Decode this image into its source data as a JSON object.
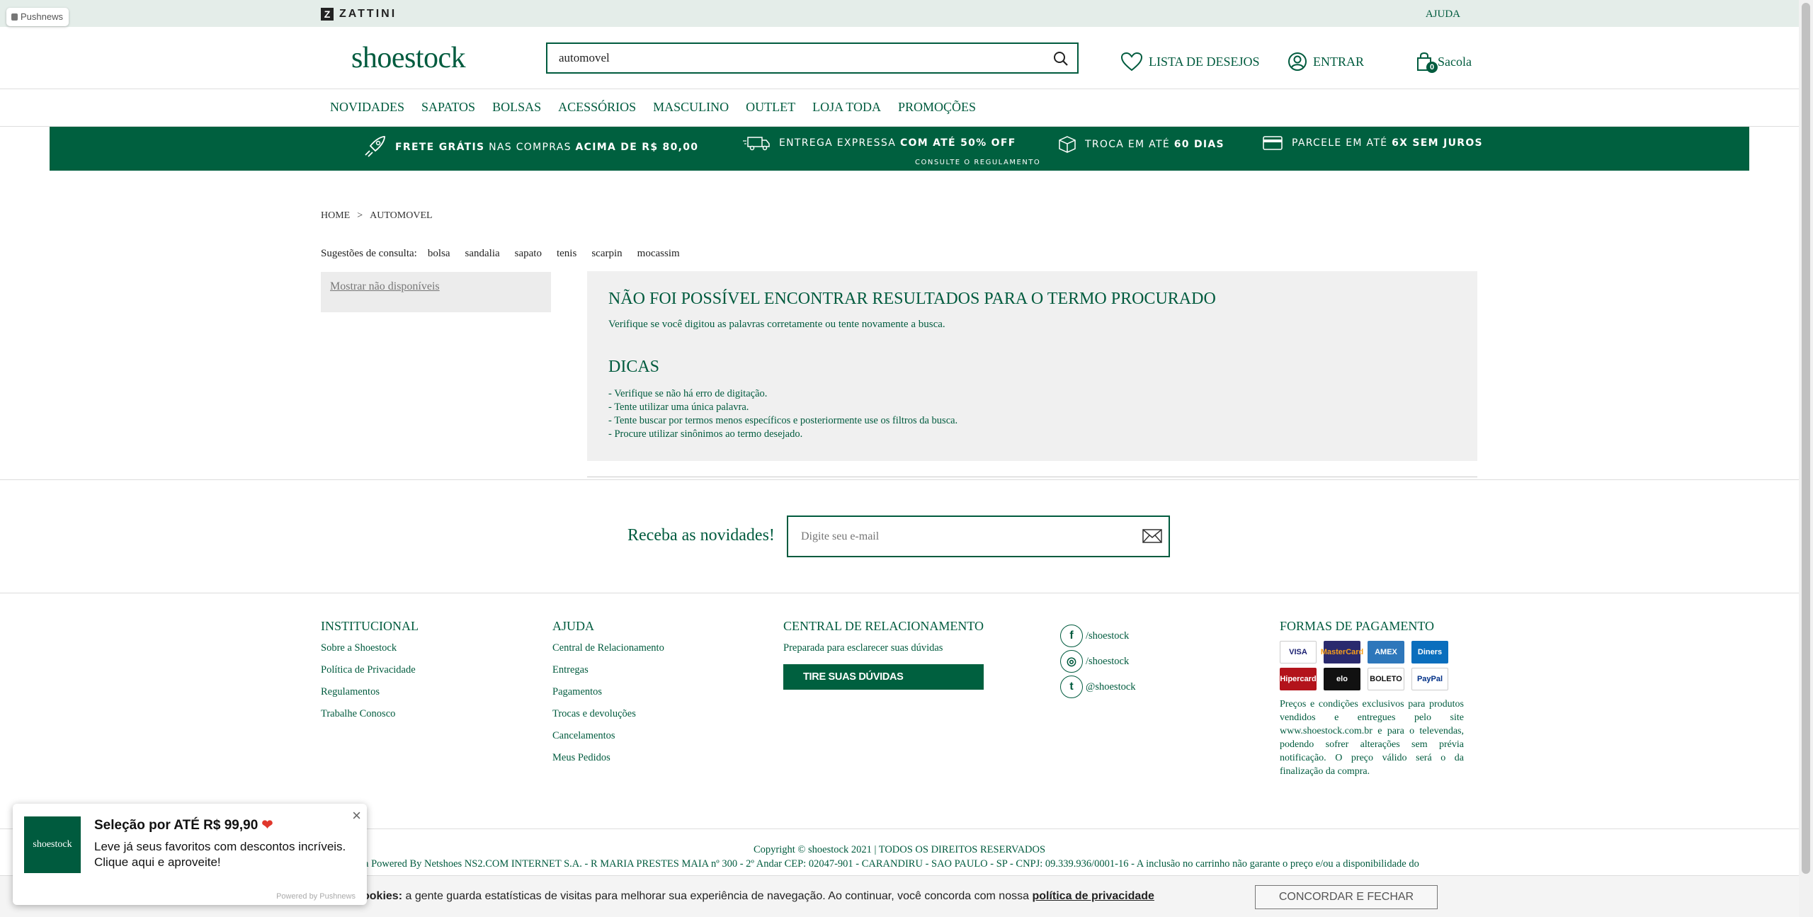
{
  "topbar": {
    "pushnews_label": "Pushnews",
    "zattini_logo": "ZATTINI",
    "zattini_mark": "Z",
    "help_link": "AJUDA"
  },
  "header": {
    "logo": "shoestock",
    "search_value": "automovel",
    "wishlist_label": "LISTA DE DESEJOS",
    "login_label": "ENTRAR",
    "bag_label": "Sacola",
    "bag_count": "0"
  },
  "nav": {
    "items": [
      "NOVIDADES",
      "SAPATOS",
      "BOLSAS",
      "ACESSÓRIOS",
      "MASCULINO",
      "OUTLET",
      "LOJA TODA",
      "PROMOÇÕES"
    ]
  },
  "promo": {
    "shipping_bold1": "FRETE GRÁTIS",
    "shipping_mid": "NAS COMPRAS",
    "shipping_bold2": "ACIMA DE R$ 80,00",
    "express_text": "ENTREGA EXPRESSA",
    "express_bold": "COM ATÉ 50% OFF",
    "express_note": "CONSULTE O REGULAMENTO",
    "exchange_text": "TROCA EM ATÉ",
    "exchange_bold": "60 DIAS",
    "installments_text": "PARCELE EM ATÉ",
    "installments_bold": "6X SEM JUROS"
  },
  "breadcrumb": {
    "home": "HOME",
    "separator": ">",
    "current": "AUTOMOVEL"
  },
  "suggestions": {
    "label": "Sugestões de consulta:",
    "terms": [
      "bolsa",
      "sandalia",
      "sapato",
      "tenis",
      "scarpin",
      "mocassim"
    ]
  },
  "filters": {
    "show_unavailable": "Mostrar não disponíveis"
  },
  "no_results": {
    "title": "NÃO FOI POSSÍVEL ENCONTRAR RESULTADOS PARA O TERMO PROCURADO",
    "subtitle": "Verifique se você digitou as palavras corretamente ou tente novamente a busca.",
    "tips_title": "DICAS",
    "tips": [
      "- Verifique se não há erro de digitação.",
      "- Tente utilizar uma única palavra.",
      "- Tente buscar por termos menos específicos e posteriormente use os filtros da busca.",
      "- Procure utilizar sinônimos ao termo desejado."
    ]
  },
  "newsletter": {
    "label": "Receba as novidades!",
    "placeholder": "Digite seu e-mail"
  },
  "footer": {
    "institutional": {
      "title": "INSTITUCIONAL",
      "links": [
        "Sobre a Shoestock",
        "Política de Privacidade",
        "Regulamentos",
        "Trabalhe Conosco"
      ]
    },
    "help": {
      "title": "AJUDA",
      "links": [
        "Central de Relacionamento",
        "Entregas",
        "Pagamentos",
        "Trocas e devoluções",
        "Cancelamentos",
        "Meus Pedidos"
      ]
    },
    "relationship": {
      "title": "CENTRAL DE RELACIONAMENTO",
      "text": "Preparada para esclarecer suas dúvidas",
      "button": "TIRE SUAS DÚVIDAS"
    },
    "social": [
      {
        "icon": "facebook-icon",
        "glyph": "f",
        "handle": "/shoestock"
      },
      {
        "icon": "instagram-icon",
        "glyph": "◎",
        "handle": "/shoestock"
      },
      {
        "icon": "twitter-icon",
        "glyph": "t",
        "handle": "@shoestock"
      }
    ],
    "payment": {
      "title": "FORMAS DE PAGAMENTO",
      "cards": [
        {
          "name": "VISA",
          "bg": "#ffffff",
          "fg": "#1a1f71"
        },
        {
          "name": "MasterCard",
          "bg": "#2a2a6e",
          "fg": "#f79e1b"
        },
        {
          "name": "AMEX",
          "bg": "#2e77bb",
          "fg": "#ffffff"
        },
        {
          "name": "Diners",
          "bg": "#0a6ebd",
          "fg": "#ffffff"
        },
        {
          "name": "Hipercard",
          "bg": "#b3131b",
          "fg": "#ffffff"
        },
        {
          "name": "elo",
          "bg": "#111111",
          "fg": "#ffffff"
        },
        {
          "name": "BOLETO",
          "bg": "#ffffff",
          "fg": "#111111"
        },
        {
          "name": "PayPal",
          "bg": "#ffffff",
          "fg": "#003087"
        }
      ],
      "text": "Preços e condições exclusivos para produtos vendidos e entregues pelo site www.shoestock.com.br e para o televendas, podendo sofrer alterações sem prévia notificação. O preço válido será o da finalização da compra."
    },
    "copyright": "Copyright © shoestock 2021 | TODOS OS DIREITOS RESERVADOS",
    "legal": "ja Powered By Netshoes NS2.COM INTERNET S.A. - R MARIA PRESTES MAIA nº 300 - 2º Andar CEP: 02047-901 - CARANDIRU - SAO PAULO - SP - CNPJ: 09.339.936/0001-16 - A inclusão no carrinho não garante o preço e/ou a disponibilidade do"
  },
  "cookie": {
    "label_bold": "ookies:",
    "text": "a gente guarda estatísticas de visitas para melhorar sua experiência de navegação. Ao continuar, você concorda com nossa",
    "link": "política de privacidade",
    "button": "CONCORDAR E FECHAR"
  },
  "push_popup": {
    "logo": "shoestock",
    "title": "Seleção por ATÉ R$ 99,90",
    "heart": "❤",
    "body": "Leve já seus favoritos com descontos incríveis. Clique aqui e aproveite!",
    "footer": "Powered by Pushnews",
    "close": "×"
  },
  "colors": {
    "brand_green": "#005b3e",
    "promo_green": "#00603f",
    "panel_gray": "#f0f0f0"
  }
}
